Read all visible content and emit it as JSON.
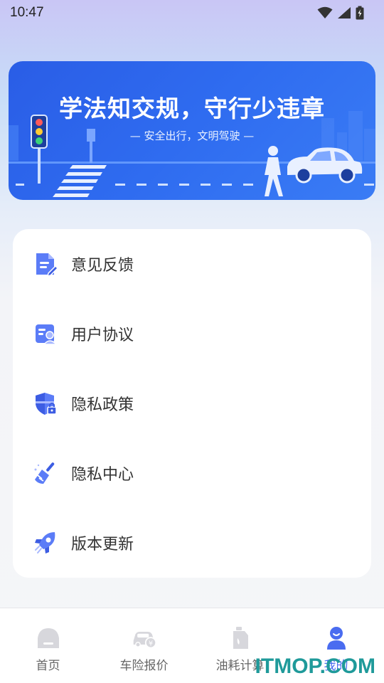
{
  "status_bar": {
    "time": "10:47"
  },
  "banner": {
    "title": "学法知交规，守行少违章",
    "subtitle": "— 安全出行，文明驾驶 —"
  },
  "menu": {
    "items": [
      {
        "label": "意见反馈",
        "icon": "feedback-document-icon"
      },
      {
        "label": "用户协议",
        "icon": "user-agreement-icon"
      },
      {
        "label": "隐私政策",
        "icon": "privacy-shield-icon"
      },
      {
        "label": "隐私中心",
        "icon": "broom-icon"
      },
      {
        "label": "版本更新",
        "icon": "rocket-icon"
      }
    ]
  },
  "tabs": [
    {
      "label": "首页",
      "icon": "home-icon",
      "active": false
    },
    {
      "label": "车险报价",
      "icon": "car-insurance-icon",
      "active": false
    },
    {
      "label": "油耗计算",
      "icon": "fuel-can-icon",
      "active": false
    },
    {
      "label": "我的",
      "icon": "user-profile-icon",
      "active": true
    }
  ],
  "watermark": "ITMOP.COM",
  "colors": {
    "accent": "#4a6cf0",
    "banner_blue": "#2f6cf0",
    "icon_blue": "#5b7cf7",
    "watermark": "#1f9a9a"
  }
}
